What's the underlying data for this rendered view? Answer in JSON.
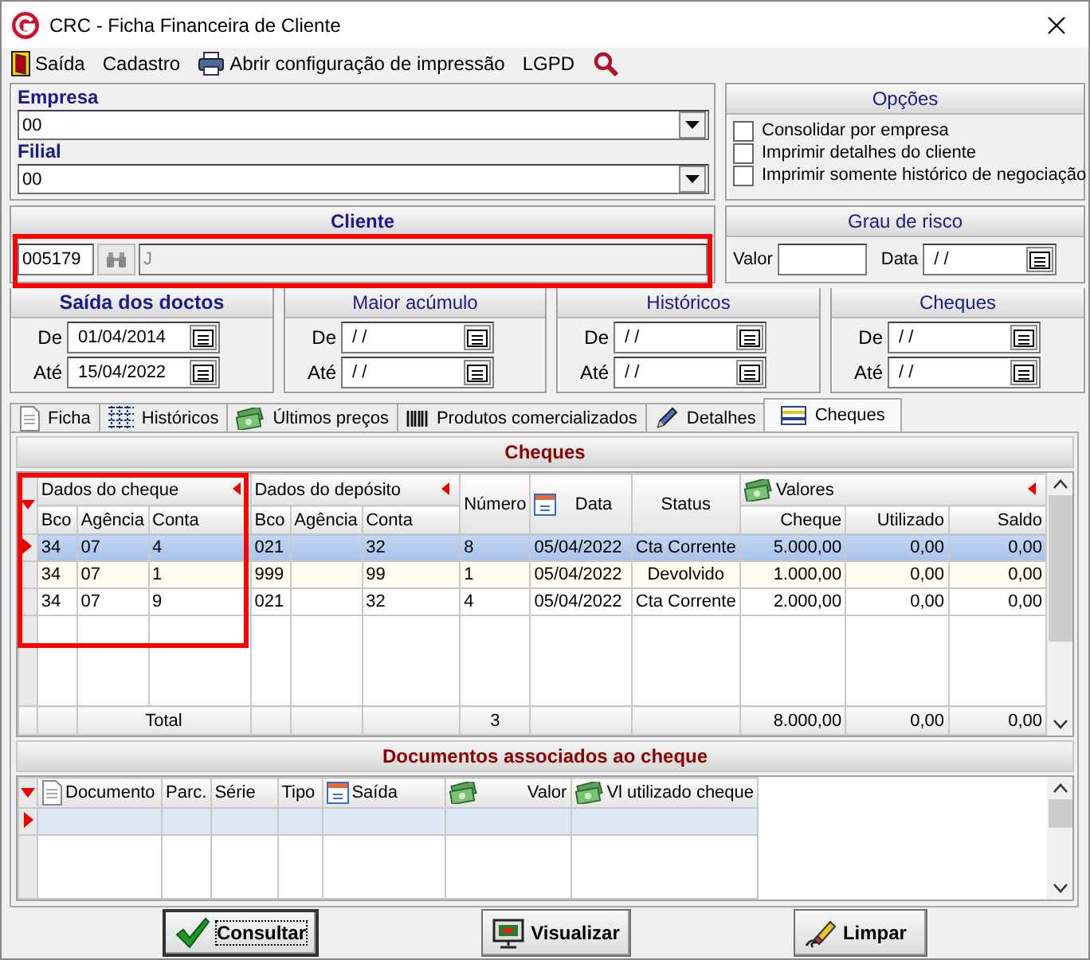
{
  "window": {
    "title": "CRC - Ficha Financeira de Cliente"
  },
  "menu": [
    {
      "label": "Saída"
    },
    {
      "label": "Cadastro"
    },
    {
      "label": "Abrir configuração de impressão"
    },
    {
      "label": "LGPD"
    }
  ],
  "empresa": {
    "label": "Empresa",
    "value": "00"
  },
  "filial": {
    "label": "Filial",
    "value": "00"
  },
  "opcoes": {
    "title": "Opções",
    "items": [
      {
        "label": "Consolidar por empresa",
        "checked": false
      },
      {
        "label": "Imprimir detalhes do cliente",
        "checked": false
      },
      {
        "label": "Imprimir somente histórico de negociação",
        "checked": false
      }
    ]
  },
  "cliente": {
    "title": "Cliente",
    "code": "005179",
    "name": "J"
  },
  "grau_de_risco": {
    "title": "Grau de risco",
    "valor_label": "Valor",
    "data_label": "Data",
    "data": "/ /"
  },
  "date_ranges": [
    {
      "title": "Saída dos doctos",
      "emphasized": true,
      "from_label": "De",
      "from": "01/04/2014",
      "to_label": "Até",
      "to": "15/04/2022"
    },
    {
      "title": "Maior acúmulo",
      "emphasized": false,
      "from_label": "De",
      "from": "/ /",
      "to_label": "Até",
      "to": "/ /"
    },
    {
      "title": "Históricos",
      "emphasized": false,
      "from_label": "De",
      "from": "/ /",
      "to_label": "Até",
      "to": "/ /"
    },
    {
      "title": "Cheques",
      "emphasized": false,
      "from_label": "De",
      "from": "/ /",
      "to_label": "Até",
      "to": "/ /"
    }
  ],
  "tabs": [
    {
      "label": "Ficha",
      "selected": false
    },
    {
      "label": "Históricos",
      "selected": false
    },
    {
      "label": "Últimos preços",
      "selected": false
    },
    {
      "label": "Produtos comercializados",
      "selected": false
    },
    {
      "label": "Detalhes",
      "selected": false
    },
    {
      "label": "Cheques",
      "selected": true
    }
  ],
  "cheques": {
    "title": "Cheques",
    "header": [
      {
        "kind": "group",
        "label": "Dados do cheque",
        "columns": [
          "Bco",
          "Agência",
          "Conta"
        ]
      },
      {
        "kind": "group",
        "label": "Dados do depósito",
        "columns": [
          "Bco",
          "Agência",
          "Conta"
        ]
      },
      {
        "kind": "single",
        "label": "Número"
      },
      {
        "kind": "single",
        "label": "Data"
      },
      {
        "kind": "single",
        "label": "Status"
      },
      {
        "kind": "group",
        "label": "Valores",
        "columns": [
          "Cheque",
          "Utilizado",
          "Saldo"
        ]
      }
    ],
    "rows": [
      {
        "selected": true,
        "cells": [
          "34",
          "07",
          "4",
          "021",
          "",
          "32",
          "8",
          "05/04/2022",
          "Cta Corrente",
          "5.000,00",
          "0,00",
          "0,00"
        ]
      },
      {
        "selected": false,
        "cells": [
          "34",
          "07",
          "1",
          "999",
          "",
          "99",
          "1",
          "05/04/2022",
          "Devolvido",
          "1.000,00",
          "0,00",
          "0,00"
        ]
      },
      {
        "selected": false,
        "cells": [
          "34",
          "07",
          "9",
          "021",
          "",
          "32",
          "4",
          "05/04/2022",
          "Cta Corrente",
          "2.000,00",
          "0,00",
          "0,00"
        ]
      }
    ],
    "total": {
      "label": "Total",
      "count": "3",
      "cheque": "8.000,00",
      "utilizado": "0,00",
      "saldo": "0,00"
    }
  },
  "documentos": {
    "title": "Documentos associados ao cheque",
    "columns": [
      "Documento",
      "Parc.",
      "Série",
      "Tipo",
      "Saída",
      "Valor",
      "Vl utilizado cheque"
    ],
    "rows": [
      {
        "selected": true
      }
    ]
  },
  "buttons": [
    {
      "label": "Consultar",
      "focused": true
    },
    {
      "label": "Visualizar",
      "focused": false
    },
    {
      "label": "Limpar",
      "focused": false
    }
  ]
}
